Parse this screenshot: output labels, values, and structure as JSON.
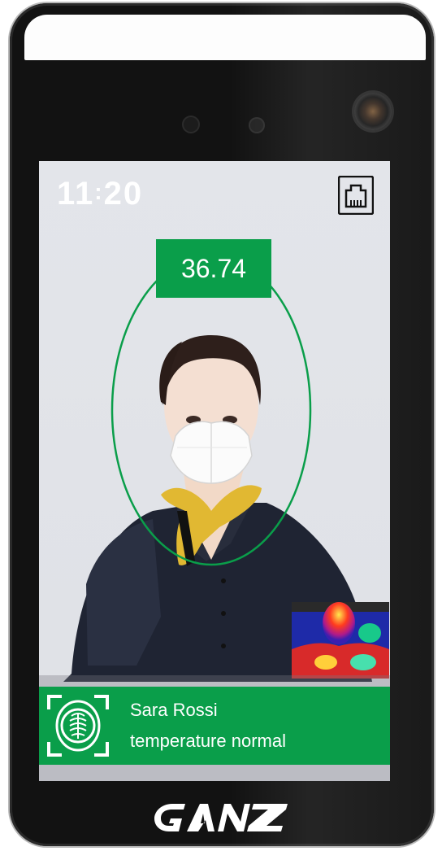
{
  "clock": {
    "hours": "11",
    "separator": ":",
    "minutes": "20"
  },
  "temperature": {
    "value": "36.74"
  },
  "recognition": {
    "name": "Sara Rossi",
    "status": "temperature normal"
  },
  "icons": {
    "network": "ethernet-port-icon",
    "recognition": "fingerprint-scan-icon",
    "brand": "ganz-logo"
  },
  "brand": {
    "logo_text": "GANZ"
  },
  "colors": {
    "accent_green": "#0a9e4a",
    "device_black": "#121212"
  }
}
